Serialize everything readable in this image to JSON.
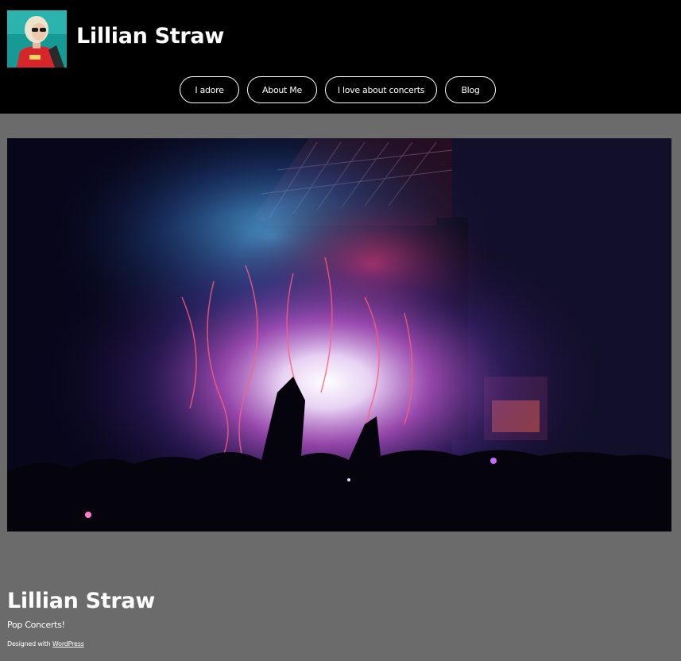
{
  "header": {
    "site_title": "Lillian Straw",
    "avatar_alt": "site-logo"
  },
  "nav": {
    "items": [
      {
        "label": "I adore"
      },
      {
        "label": "About Me"
      },
      {
        "label": "I love about concerts"
      },
      {
        "label": "Blog"
      }
    ]
  },
  "hero": {
    "image": "concert-stage-photo"
  },
  "footer": {
    "title": "Lillian Straw",
    "tagline": "Pop Concerts!",
    "credit_prefix": "Designed with ",
    "credit_link": "WordPress"
  },
  "colors": {
    "header_bg": "#000000",
    "page_bg": "#6b6b6b",
    "text": "#ffffff"
  }
}
